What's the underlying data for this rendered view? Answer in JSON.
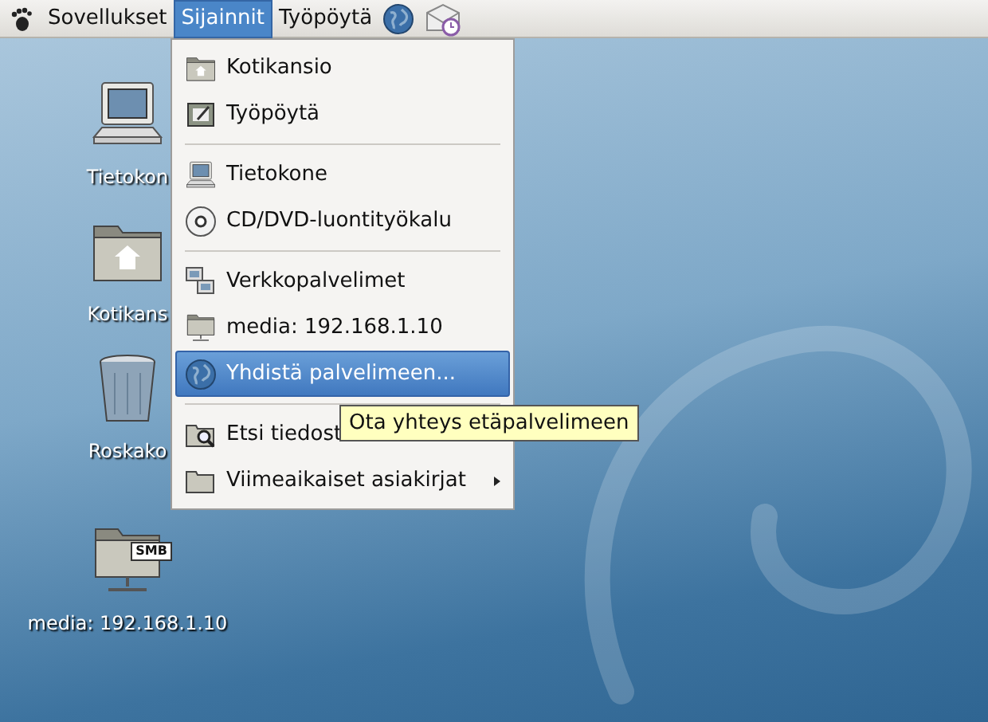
{
  "top_panel": {
    "menus": [
      {
        "label": "Sovellukset",
        "selected": false
      },
      {
        "label": "Sijainnit",
        "selected": true
      },
      {
        "label": "Työpöytä",
        "selected": false
      }
    ],
    "launchers": [
      {
        "kind": "globe"
      },
      {
        "kind": "mail"
      }
    ]
  },
  "desktop_icons": [
    {
      "kind": "computer",
      "label": "Tietokon"
    },
    {
      "kind": "home",
      "label": "Kotikans"
    },
    {
      "kind": "trash",
      "label": "Roskako"
    },
    {
      "kind": "smb",
      "label": "media: 192.168.1.10",
      "badge": "SMB"
    }
  ],
  "places_menu": {
    "items": [
      {
        "kind": "home",
        "label": "Kotikansio",
        "selected": false,
        "has_submenu": false
      },
      {
        "kind": "desktop",
        "label": "Työpöytä",
        "selected": false,
        "has_submenu": false
      },
      {
        "kind": "separator"
      },
      {
        "kind": "computer",
        "label": "Tietokone",
        "selected": false,
        "has_submenu": false
      },
      {
        "kind": "cd",
        "label": "CD/DVD-luontityökalu",
        "selected": false,
        "has_submenu": false
      },
      {
        "kind": "separator"
      },
      {
        "kind": "network",
        "label": "Verkkopalvelimet",
        "selected": false,
        "has_submenu": false
      },
      {
        "kind": "smb",
        "label": "media: 192.168.1.10",
        "selected": false,
        "has_submenu": false
      },
      {
        "kind": "globe",
        "label": "Yhdistä palvelimeen...",
        "selected": true,
        "has_submenu": false
      },
      {
        "kind": "separator"
      },
      {
        "kind": "search",
        "label": "Etsi tiedost",
        "selected": false,
        "has_submenu": false
      },
      {
        "kind": "folder",
        "label": "Viimeaikaiset asiakirjat",
        "selected": false,
        "has_submenu": true
      }
    ]
  },
  "tooltip": {
    "text": "Ota yhteys etäpalvelimeen"
  }
}
